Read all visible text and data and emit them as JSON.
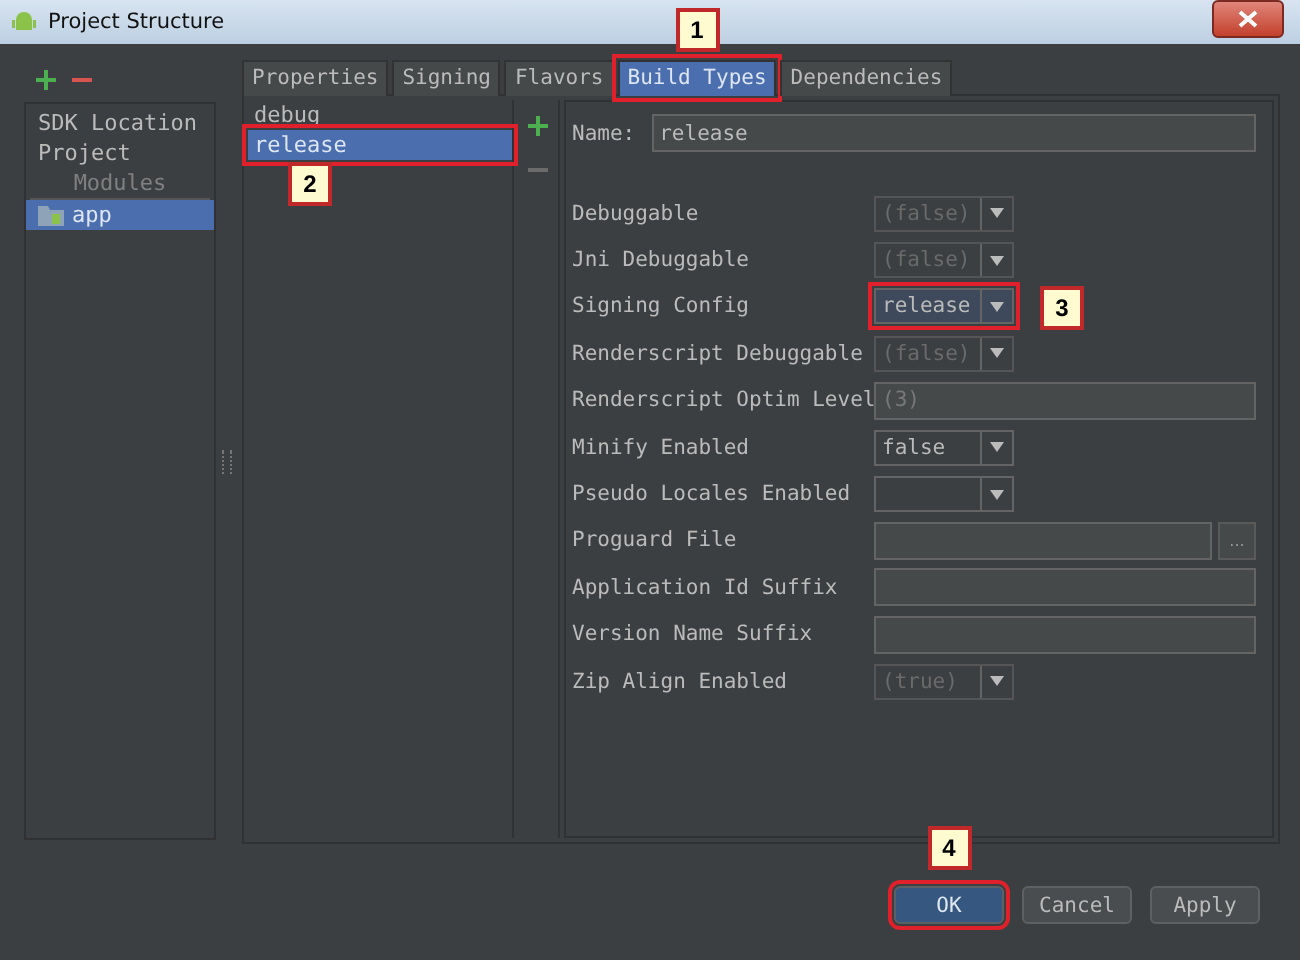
{
  "window": {
    "title": "Project Structure"
  },
  "sidebar": {
    "items": [
      {
        "kind": "item",
        "label": "SDK Location",
        "selected": false
      },
      {
        "kind": "item",
        "label": "Project",
        "selected": false
      },
      {
        "kind": "header",
        "label": "Modules"
      },
      {
        "kind": "module",
        "label": "app",
        "selected": true
      }
    ]
  },
  "tabs": [
    {
      "label": "Properties",
      "selected": false,
      "highlighted": false
    },
    {
      "label": "Signing",
      "selected": false,
      "highlighted": false
    },
    {
      "label": "Flavors",
      "selected": false,
      "highlighted": false
    },
    {
      "label": "Build Types",
      "selected": true,
      "highlighted": true,
      "callout": "1"
    },
    {
      "label": "Dependencies",
      "selected": false,
      "highlighted": false
    }
  ],
  "build_types": [
    {
      "label": "debug",
      "selected": false,
      "highlighted": false
    },
    {
      "label": "release",
      "selected": true,
      "highlighted": true,
      "callout": "2"
    }
  ],
  "name_field": {
    "label": "Name:",
    "value": "release"
  },
  "fields": [
    {
      "kind": "combo",
      "label": "Debuggable",
      "value": "(false)",
      "dimmed": true,
      "highlighted": false
    },
    {
      "kind": "combo",
      "label": "Jni Debuggable",
      "value": "(false)",
      "dimmed": true,
      "highlighted": false
    },
    {
      "kind": "combo",
      "label": "Signing Config",
      "value": "release",
      "dimmed": false,
      "highlighted": true,
      "callout": "3"
    },
    {
      "kind": "combo",
      "label": "Renderscript Debuggable",
      "value": "(false)",
      "dimmed": true,
      "highlighted": false
    },
    {
      "kind": "text",
      "label": "Renderscript Optim Level",
      "value": "(3)",
      "dimmed": true
    },
    {
      "kind": "combo",
      "label": "Minify Enabled",
      "value": "false",
      "dimmed": false,
      "highlighted": false
    },
    {
      "kind": "combo",
      "label": "Pseudo Locales Enabled",
      "highlighted": false
    },
    {
      "kind": "file",
      "label": "Proguard File",
      "button": "..."
    },
    {
      "kind": "text",
      "label": "Application Id Suffix"
    },
    {
      "kind": "text",
      "label": "Version Name Suffix"
    },
    {
      "kind": "combo",
      "label": "Zip Align Enabled",
      "value": "(true)",
      "dimmed": true,
      "highlighted": false
    }
  ],
  "buttons": [
    {
      "label": "OK",
      "default": true,
      "highlighted": true,
      "callout": "4"
    },
    {
      "label": "Cancel",
      "default": false,
      "highlighted": false
    },
    {
      "label": "Apply",
      "default": false,
      "highlighted": false
    }
  ]
}
